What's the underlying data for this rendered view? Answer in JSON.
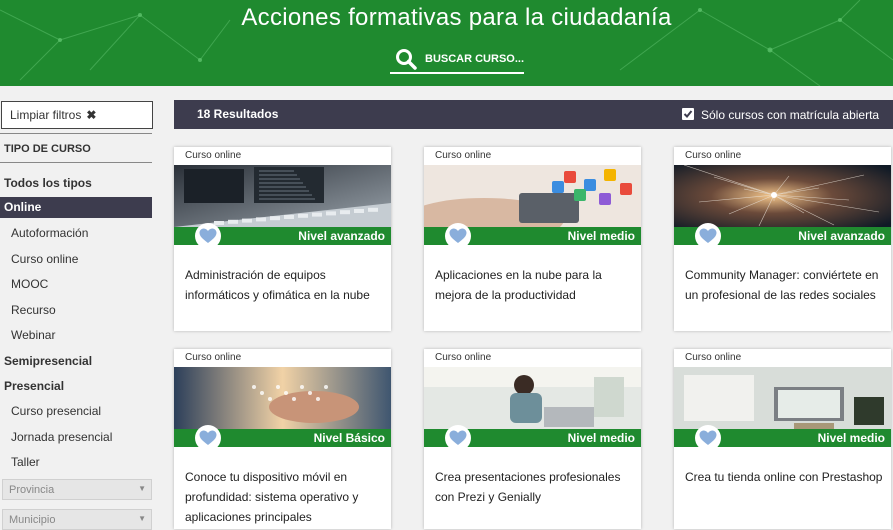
{
  "header": {
    "title": "Acciones formativas para la ciudadanía",
    "search_label": "BUSCAR CURSO..."
  },
  "sidebar": {
    "clear_filters": "Limpiar filtros",
    "heading": "TIPO DE CURSO",
    "all_types": "Todos los tipos",
    "online": "Online",
    "online_items": [
      "Autoformación",
      "Curso online",
      "MOOC",
      "Recurso",
      "Webinar"
    ],
    "semipresencial": "Semipresencial",
    "presencial": "Presencial",
    "presencial_items": [
      "Curso presencial",
      "Jornada presencial",
      "Taller"
    ],
    "province_select": "Provincia",
    "municipality_select": "Municipio"
  },
  "results": {
    "count": "18 Resultados",
    "only_open_label": "Sólo cursos con matrícula abierta",
    "only_open_checked": true
  },
  "colors": {
    "green": "#1f8a2f",
    "dark_bar": "#3d3c4e",
    "heart": "#8aaedb"
  },
  "cards": [
    {
      "type": "Curso online",
      "level": "Nivel avanzado",
      "title": "Administración de equipos informáticos y ofimática en la nube",
      "image": "keyboard-monitors"
    },
    {
      "type": "Curso online",
      "level": "Nivel medio",
      "title": "Aplicaciones en la nube para la mejora de la productividad",
      "image": "phone-cloud-apps"
    },
    {
      "type": "Curso online",
      "level": "Nivel avanzado",
      "title": "Community Manager: conviértete en un profesional de las redes sociales",
      "image": "network-earth"
    },
    {
      "type": "Curso online",
      "level": "Nivel Básico",
      "title": "Conoce tu dispositivo móvil en profundidad: sistema operativo y aplicaciones principales",
      "image": "hand-sunset"
    },
    {
      "type": "Curso online",
      "level": "Nivel medio",
      "title": "Crea presentaciones profesionales con Prezi y Genially",
      "image": "woman-laptop"
    },
    {
      "type": "Curso online",
      "level": "Nivel medio",
      "title": "Crea tu tienda online con Prestashop",
      "image": "online-shop"
    }
  ]
}
